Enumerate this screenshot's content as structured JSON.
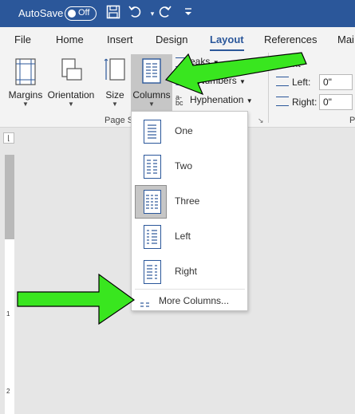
{
  "titlebar": {
    "autosave_label": "AutoSave",
    "autosave_state": "Off",
    "save_icon": "save-icon",
    "undo_icon": "undo-icon",
    "redo_icon": "redo-icon",
    "customize_icon": "customize-quick-access-icon",
    "bg_color": "#2b579a"
  },
  "tabs": [
    {
      "label": "File"
    },
    {
      "label": "Home"
    },
    {
      "label": "Insert"
    },
    {
      "label": "Design"
    },
    {
      "label": "Layout",
      "active": true
    },
    {
      "label": "References"
    },
    {
      "label": "Mai"
    }
  ],
  "ribbon": {
    "margins": {
      "label": "Margins",
      "icon": "margins-icon"
    },
    "orientation": {
      "label": "Orientation",
      "icon": "orientation-icon"
    },
    "size": {
      "label": "Size",
      "icon": "size-icon"
    },
    "columns": {
      "label": "Columns",
      "icon": "columns-icon"
    },
    "breaks": {
      "label": "eaks",
      "icon": "breaks-icon"
    },
    "line_numbers": {
      "label": "e Numbers",
      "icon": "line-numbers-icon"
    },
    "hyphenation": {
      "label": "Hyphenation",
      "icon": "hyphenation-icon"
    },
    "group_label": "Page S",
    "indent_header": "ent",
    "indent_left_label": "Left:",
    "indent_left_value": "0\"",
    "indent_right_label": "Right:",
    "indent_right_value": "0\"",
    "right_group_partial": "P"
  },
  "columns_menu": {
    "items": [
      {
        "label": "One",
        "icon": "one-column-icon"
      },
      {
        "label": "Two",
        "icon": "two-columns-icon"
      },
      {
        "label": "Three",
        "icon": "three-columns-icon",
        "selected": true
      },
      {
        "label": "Left",
        "icon": "left-column-icon"
      },
      {
        "label": "Right",
        "icon": "right-column-icon"
      }
    ],
    "more_label": "More Columns...",
    "more_icon": "more-columns-icon"
  },
  "ruler": {
    "numbers": [
      "1",
      "2"
    ]
  },
  "annotation": {
    "arrow_color": "#39e61f"
  }
}
